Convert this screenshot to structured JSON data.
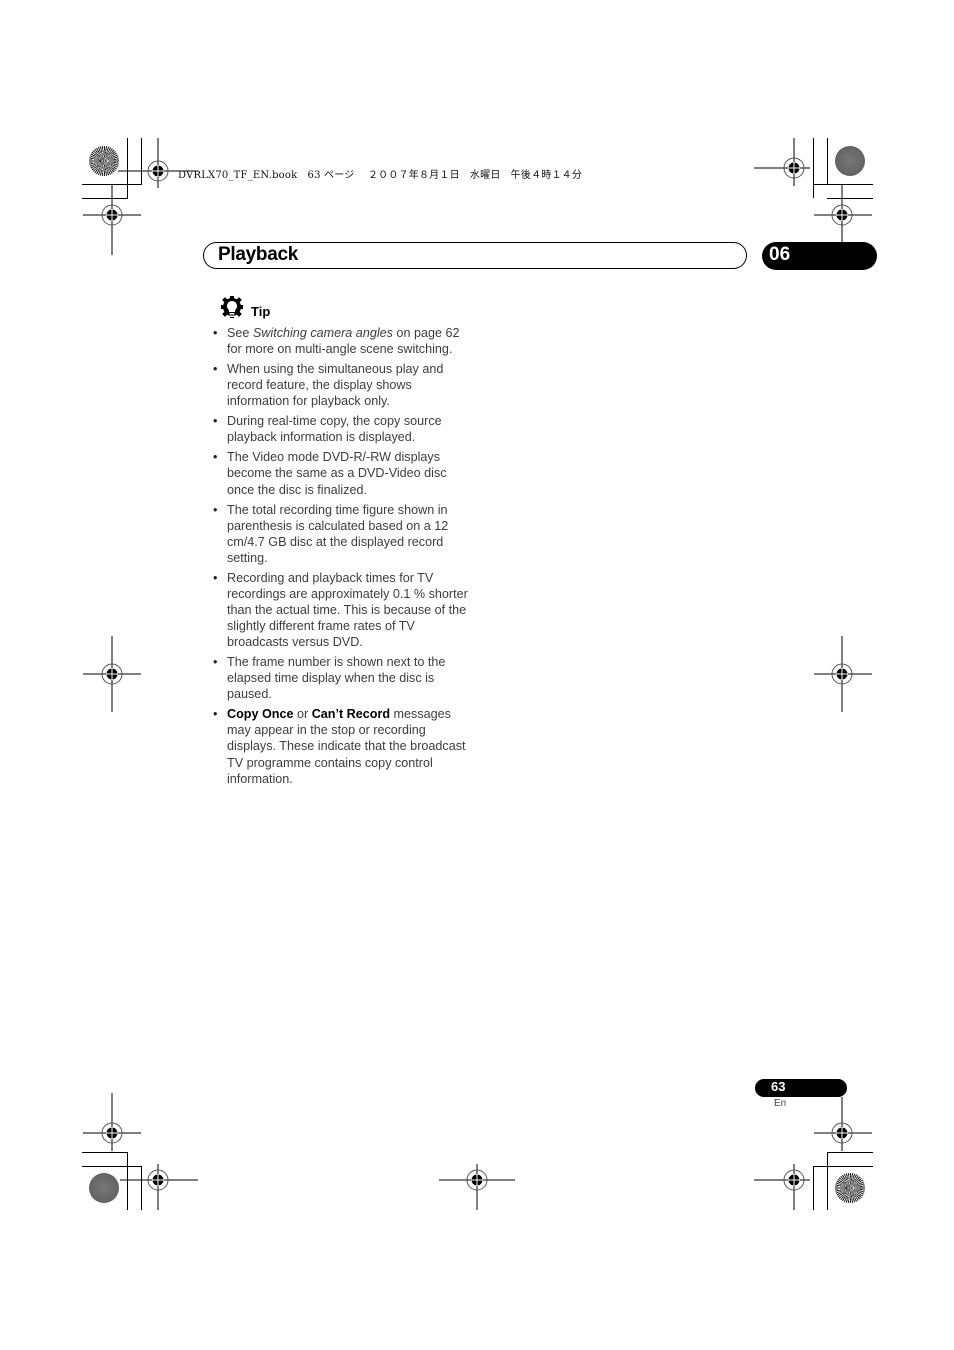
{
  "print_header": {
    "filename": "DVRLX70_TF_EN.book",
    "page": "63",
    "page_word": "ページ",
    "date": "２００７年８月１日",
    "weekday": "水曜日",
    "time": "午後４時１４分"
  },
  "section": {
    "title": "Playback",
    "chapter_number": "06"
  },
  "tip": {
    "icon": "lightbulb-gear-icon",
    "label": "Tip",
    "items": [
      {
        "segments": [
          {
            "text": "See ",
            "style": "normal"
          },
          {
            "text": "Switching camera angles",
            "style": "italic"
          },
          {
            "text": " on page 62 for more on multi-angle scene switching.",
            "style": "normal"
          }
        ]
      },
      {
        "segments": [
          {
            "text": "When using the simultaneous play and record feature, the display shows information for playback only.",
            "style": "normal"
          }
        ]
      },
      {
        "segments": [
          {
            "text": "During real-time copy, the copy source playback information is displayed.",
            "style": "normal"
          }
        ]
      },
      {
        "segments": [
          {
            "text": "The Video mode DVD-R/-RW displays become the same as a DVD-Video disc once the disc is finalized.",
            "style": "normal"
          }
        ]
      },
      {
        "segments": [
          {
            "text": "The total recording time figure shown in parenthesis is calculated based on a 12 cm/4.7 GB disc at the displayed record setting.",
            "style": "normal"
          }
        ]
      },
      {
        "segments": [
          {
            "text": "Recording and playback times for TV recordings are approximately 0.1 % shorter than the actual time. This is because of the slightly different frame rates of TV broadcasts versus DVD.",
            "style": "normal"
          }
        ]
      },
      {
        "segments": [
          {
            "text": "The frame number is shown next to the elapsed time display when the disc is paused.",
            "style": "normal"
          }
        ]
      },
      {
        "segments": [
          {
            "text": "Copy Once",
            "style": "bold"
          },
          {
            "text": " or ",
            "style": "normal"
          },
          {
            "text": "Can’t Record",
            "style": "bold"
          },
          {
            "text": " messages may appear in the stop or recording displays. These indicate that the broadcast TV programme contains copy control information.",
            "style": "normal"
          }
        ]
      }
    ]
  },
  "footer": {
    "page_number": "63",
    "language": "En"
  }
}
